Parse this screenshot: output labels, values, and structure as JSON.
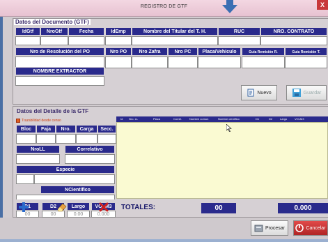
{
  "window": {
    "title": "REGISTRO DE GTF",
    "close_label": "X"
  },
  "documento": {
    "section_title": "Datos del Documento (GTF)",
    "row1_headers": [
      "IdGtf",
      "NroGtf",
      "Fecha",
      "IdEmp",
      "Nombre del Titular del T. H.",
      "RUC",
      "NRO. CONTRATO"
    ],
    "row2_headers": [
      "Nro de Resolución del PO",
      "Nro PO",
      "Nro Zafra",
      "Nro PC",
      "Placa/Vehiculo",
      "Guia Remisión R.",
      "Guia Remisión T."
    ],
    "row3_headers": [
      "NOMBRE EXTRACTOR"
    ],
    "nuevo_label": "Nuevo",
    "guardar_label": "Guardar"
  },
  "detalle": {
    "section_title": "Datos del Detalle de la GTF",
    "checkbox_label": "Trazabilidad desde censo",
    "row1_headers": [
      "Bloc",
      "Faja",
      "Nro.",
      "Carga",
      "Secc."
    ],
    "nrold_label": "NroLL",
    "correlativo_label": "Correlativo",
    "especie_label": "Especie",
    "ncientifico_label": "NCientifico",
    "measure_headers": [
      "D1",
      "D2",
      "Largo",
      "VOLM3"
    ],
    "measure_values": [
      "00",
      "00",
      "0.00",
      "0.000"
    ]
  },
  "grid": {
    "columns": [
      "Id",
      "Nro. LL",
      "Placa",
      "Correl.",
      "Nombre comun",
      "Nombre cientifico",
      "D1",
      "D2",
      "Largo",
      "VOLM3"
    ]
  },
  "totals": {
    "label": "TOTALES:",
    "count": "00",
    "volume": "0.000"
  },
  "actions": {
    "procesar_label": "Procesar",
    "cancelar_label": "Cancelar"
  },
  "colors": {
    "header_blue": "#2a2a8c",
    "grid_yellow": "#fafad2",
    "title_pink": "#efcfdc"
  }
}
